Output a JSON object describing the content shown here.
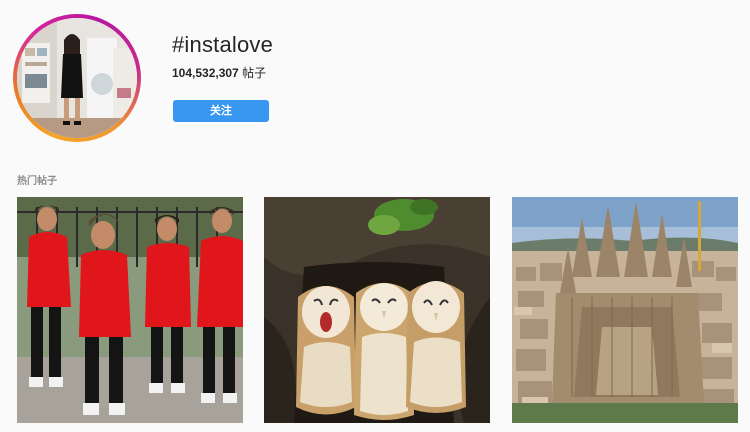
{
  "header": {
    "hashtag": "#instalove",
    "post_count": "104,532,307",
    "post_unit": "帖子",
    "follow_label": "关注"
  },
  "section": {
    "title": "热门帖子"
  },
  "posts": [
    {
      "subject": "four-men-red-shirts"
    },
    {
      "subject": "three-barn-owls"
    },
    {
      "subject": "sagrada-familia-barcelona"
    }
  ],
  "colors": {
    "follow_button": "#3897f0",
    "ring_start": "#f5a623",
    "ring_end": "#d6249f"
  }
}
